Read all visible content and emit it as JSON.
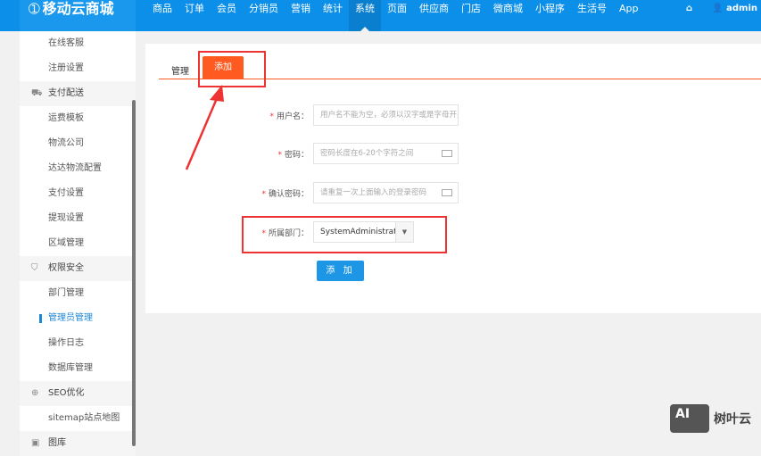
{
  "header": {
    "logo": "移动云商城",
    "nav": [
      "商品",
      "订单",
      "会员",
      "分销员",
      "营销",
      "统计",
      "系统",
      "页面",
      "供应商",
      "门店",
      "微商城",
      "小程序",
      "生活号",
      "App"
    ],
    "active_nav": "系统",
    "user": "admin"
  },
  "sidebar": {
    "items": [
      {
        "label": "在线客服",
        "type": "item"
      },
      {
        "label": "注册设置",
        "type": "item"
      },
      {
        "label": "支付配送",
        "type": "group",
        "icon": "truck-icon"
      },
      {
        "label": "运费模板",
        "type": "item"
      },
      {
        "label": "物流公司",
        "type": "item"
      },
      {
        "label": "达达物流配置",
        "type": "item"
      },
      {
        "label": "支付设置",
        "type": "item"
      },
      {
        "label": "提现设置",
        "type": "item"
      },
      {
        "label": "区域管理",
        "type": "item"
      },
      {
        "label": "权限安全",
        "type": "group",
        "icon": "shield-icon"
      },
      {
        "label": "部门管理",
        "type": "item"
      },
      {
        "label": "管理员管理",
        "type": "item",
        "active": true
      },
      {
        "label": "操作日志",
        "type": "item"
      },
      {
        "label": "数据库管理",
        "type": "item"
      },
      {
        "label": "SEO优化",
        "type": "group",
        "icon": "target-icon"
      },
      {
        "label": "sitemap站点地图",
        "type": "item"
      },
      {
        "label": "图库",
        "type": "group",
        "icon": "image-icon"
      }
    ]
  },
  "tabs": {
    "manage": "管理",
    "add": "添加"
  },
  "form": {
    "username": {
      "label": "用户名：",
      "placeholder": "用户名不能为空，必须以汉字或是字母开头"
    },
    "password": {
      "label": "密码：",
      "placeholder": "密码长度在6-20个字符之间"
    },
    "confirm": {
      "label": "确认密码：",
      "placeholder": "请重复一次上面输入的登录密码"
    },
    "department": {
      "label": "所属部门：",
      "value": "SystemAdministrator"
    },
    "submit": "添 加"
  },
  "watermark": {
    "badge": "AI",
    "text": "树叶云"
  }
}
